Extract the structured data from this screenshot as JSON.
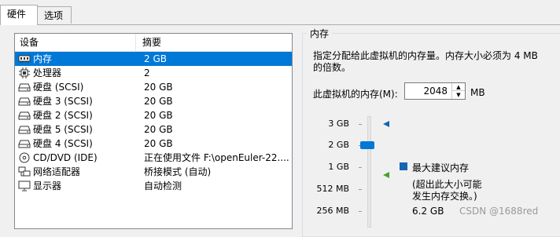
{
  "tabs": [
    {
      "label": "硬件"
    },
    {
      "label": "选项"
    }
  ],
  "device_table": {
    "col_device": "设备",
    "col_summary": "摘要",
    "rows": [
      {
        "name": "内存",
        "summary": "2 GB",
        "icon": "memory-icon",
        "selected": true
      },
      {
        "name": "处理器",
        "summary": "2",
        "icon": "cpu-icon"
      },
      {
        "name": "硬盘 (SCSI)",
        "summary": "20 GB",
        "icon": "hard-disk-icon"
      },
      {
        "name": "硬盘 3 (SCSI)",
        "summary": "20 GB",
        "icon": "hard-disk-icon"
      },
      {
        "name": "硬盘 2 (SCSI)",
        "summary": "20 GB",
        "icon": "hard-disk-icon"
      },
      {
        "name": "硬盘 5 (SCSI)",
        "summary": "20 GB",
        "icon": "hard-disk-icon"
      },
      {
        "name": "硬盘 4 (SCSI)",
        "summary": "20 GB",
        "icon": "hard-disk-icon"
      },
      {
        "name": "CD/DVD (IDE)",
        "summary": "正在使用文件 F:\\openEuler-22....",
        "icon": "cd-dvd-icon"
      },
      {
        "name": "网络适配器",
        "summary": "桥接模式 (自动)",
        "icon": "network-adapter-icon"
      },
      {
        "name": "显示器",
        "summary": "自动检测",
        "icon": "monitor-icon"
      }
    ]
  },
  "memory": {
    "group_title": "内存",
    "description": "指定分配给此虚拟机的内存量。内存大小必须为 4 MB 的倍数。",
    "field_label": "此虚拟机的内存(M):",
    "value": "2048",
    "unit": "MB",
    "ticks": [
      "3 GB",
      "2 GB",
      "1 GB",
      "512 MB",
      "256 MB"
    ],
    "max_recommended_label": "最大建议内存",
    "max_note_line1": "(超出此大小可能",
    "max_note_line2": "发生内存交换。)",
    "max_value": "6.2 GB",
    "colors": {
      "recommended_marker": "#1464b4",
      "guest_marker": "#4aa02c",
      "accent": "#0078d7"
    }
  },
  "watermark": "CSDN @1688red"
}
